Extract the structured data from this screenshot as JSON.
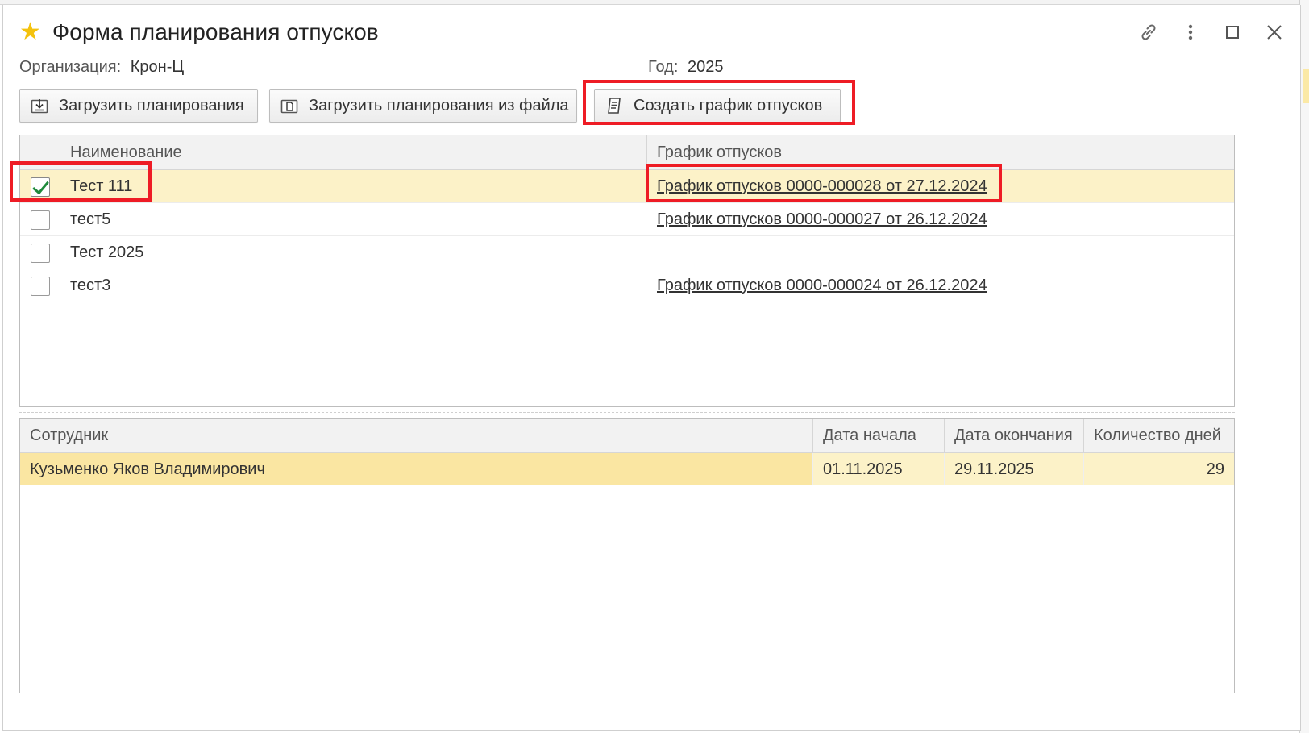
{
  "window": {
    "title": "Форма планирования отпусков",
    "icons": [
      "star-icon",
      "link-icon",
      "more-icon",
      "maximize-icon",
      "close-icon"
    ]
  },
  "info": {
    "org_label": "Организация:",
    "org_value": "Крон-Ц",
    "year_label": "Год:",
    "year_value": "2025"
  },
  "toolbar": {
    "load_planning": "Загрузить планирования",
    "load_from_file": "Загрузить планирования из файла",
    "create_schedule": "Создать график отпусков"
  },
  "plans_table": {
    "headers": {
      "name": "Наименование",
      "schedule": "График отпусков"
    },
    "rows": [
      {
        "checked": true,
        "name": "Тест 111",
        "schedule": "График отпусков 0000-000028 от 27.12.2024"
      },
      {
        "checked": false,
        "name": "тест5",
        "schedule": "График отпусков 0000-000027 от 26.12.2024"
      },
      {
        "checked": false,
        "name": "Тест 2025",
        "schedule": ""
      },
      {
        "checked": false,
        "name": "тест3",
        "schedule": "График отпусков 0000-000024 от 26.12.2024"
      }
    ]
  },
  "employees_table": {
    "headers": {
      "employee": "Сотрудник",
      "start": "Дата начала",
      "end": "Дата окончания",
      "days": "Количество дней"
    },
    "rows": [
      {
        "employee": "Кузьменко Яков Владимирович",
        "start": "01.11.2025",
        "end": "29.11.2025",
        "days": "29"
      }
    ]
  },
  "colors": {
    "highlight": "#ee1c25",
    "selected_row": "#fcf2c8",
    "current_cell": "#fae6a2",
    "checkmark": "#1f8a3b",
    "star": "#f4c20d"
  }
}
